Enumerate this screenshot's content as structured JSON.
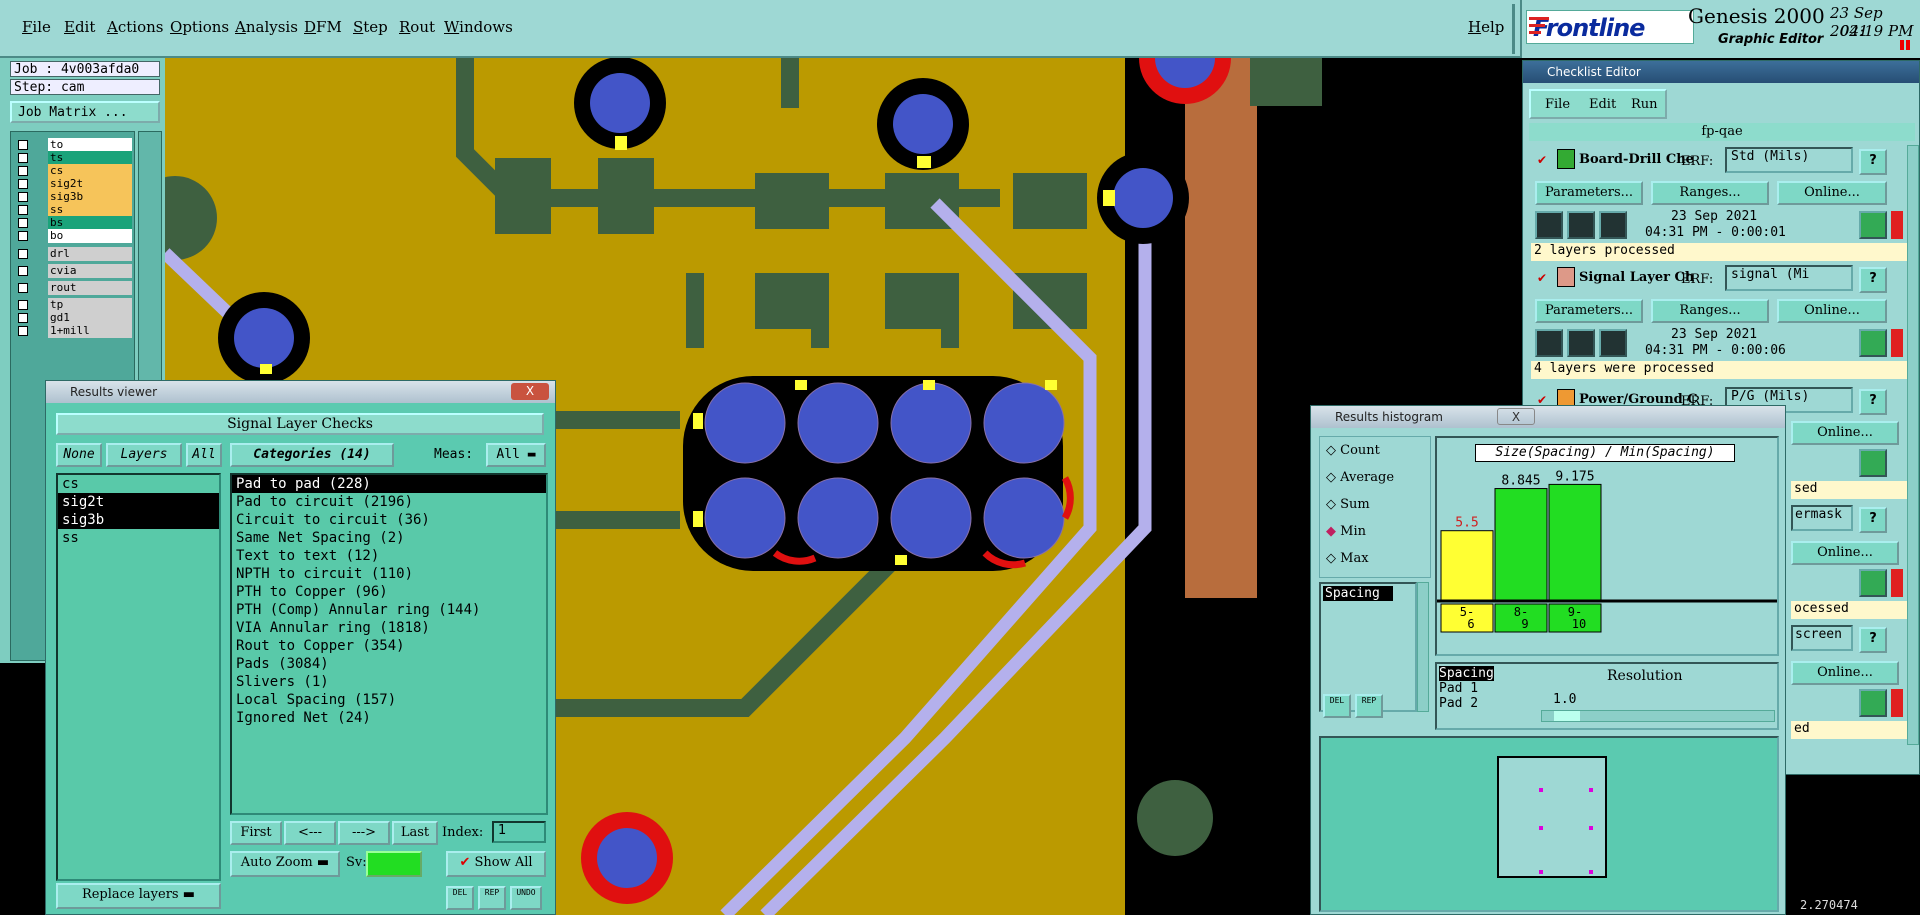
{
  "menu": {
    "items": [
      "File",
      "Edit",
      "Actions",
      "Options",
      "Analysis",
      "DFM",
      "Step",
      "Rout",
      "Windows"
    ],
    "help": "Help"
  },
  "brand": {
    "logo": "Frontline",
    "product": "Genesis 2000",
    "subtitle": "Graphic Editor",
    "date": "23 Sep 2021",
    "time": "04:19 PM"
  },
  "left": {
    "job": "Job : 4v003afda0",
    "step": "Step: cam",
    "job_matrix": "Job Matrix ...",
    "layers": [
      {
        "name": "to",
        "color": "#ffffff"
      },
      {
        "name": "ts",
        "color": "#1aa37a"
      },
      {
        "name": "cs",
        "color": "#f6c45a"
      },
      {
        "name": "sig2t",
        "color": "#f6c45a"
      },
      {
        "name": "sig3b",
        "color": "#f6c45a"
      },
      {
        "name": "ss",
        "color": "#f6c45a"
      },
      {
        "name": "bs",
        "color": "#1aa37a"
      },
      {
        "name": "bo",
        "color": "#ffffff"
      },
      {
        "name": "drl",
        "color": "#cfcfcf"
      },
      {
        "name": "cvia",
        "color": "#cfcfcf"
      },
      {
        "name": "rout",
        "color": "#cfcfcf"
      },
      {
        "name": "tp",
        "color": "#cfcfcf"
      },
      {
        "name": "gd1",
        "color": "#cfcfcf"
      },
      {
        "name": "1+mill",
        "color": "#cfcfcf"
      }
    ]
  },
  "results_viewer": {
    "title": "Results viewer",
    "close": "X",
    "header": "Signal Layer Checks",
    "none_btn": "None",
    "layers_btn": "Layers",
    "all_btn": "All",
    "categories_label": "Categories (14)",
    "meas_label": "Meas:",
    "meas_value": "All",
    "layer_list": [
      "cs",
      "sig2t",
      "sig3b",
      "ss"
    ],
    "categories": [
      "Pad to pad (228)",
      "Pad to circuit (2196)",
      "Circuit to circuit (36)",
      "Same Net Spacing (2)",
      "Text to text (12)",
      "NPTH to circuit (110)",
      "PTH to Copper (96)",
      "PTH (Comp) Annular ring (144)",
      "VIA Annular ring (1818)",
      "Rout to Copper (354)",
      "Pads (3084)",
      "Slivers (1)",
      "Local Spacing (157)",
      "Ignored Net (24)"
    ],
    "first": "First",
    "prev": "<---",
    "next": "--->",
    "last": "Last",
    "index_label": "Index:",
    "index_value": "1",
    "auto_zoom": "Auto Zoom",
    "sv_label": "Sv:",
    "show_all": "Show All",
    "replace_layers": "Replace layers",
    "del": "DEL",
    "rep": "REP",
    "undo": "UNDO"
  },
  "checklist": {
    "title": "Checklist Editor",
    "menu": [
      "File",
      "Edit",
      "Run"
    ],
    "name": "fp-qae",
    "checks": [
      {
        "name": "Board-Drill Che",
        "erf_label": "ERF:",
        "erf": "Std (Mils)",
        "params": "Parameters...",
        "ranges": "Ranges...",
        "online": "Online...",
        "date": "23 Sep 2021",
        "time": "04:31 PM - 0:00:01",
        "status": "2 layers processed"
      },
      {
        "name": "Signal Layer Ch",
        "erf_label": "ERF:",
        "erf": "signal (Mi",
        "params": "Parameters...",
        "ranges": "Ranges...",
        "online": "Online...",
        "date": "23 Sep 2021",
        "time": "04:31 PM - 0:00:06",
        "status": "4 layers were processed"
      },
      {
        "name": "Power/Ground C",
        "erf_label": "ERF:",
        "erf": "P/G (Mils)"
      }
    ],
    "fragments": [
      "Online...",
      "sed",
      "ermask",
      "Online...",
      "ocessed",
      "screen",
      "Online...",
      "ed"
    ]
  },
  "histogram": {
    "title": "Results histogram",
    "close": "X",
    "modes": [
      "Count",
      "Average",
      "Sum",
      "Min",
      "Max"
    ],
    "selected_mode": "Min",
    "measure_item": "Spacing",
    "chart_title": "Size(Spacing) / Min(Spacing)",
    "bars": [
      {
        "range": "5-6",
        "value": "5.5",
        "color": "#ffff33"
      },
      {
        "range": "8-9",
        "value": "8.845",
        "color": "#22dd22"
      },
      {
        "range": "9-10",
        "value": "9.175",
        "color": "#22dd22"
      }
    ],
    "fields": [
      "Spacing",
      "Pad 1",
      "Pad 2"
    ],
    "resolution_label": "Resolution",
    "resolution_value": "1.0",
    "del": "DEL",
    "rep": "REP"
  },
  "status_coord": "2.270474"
}
